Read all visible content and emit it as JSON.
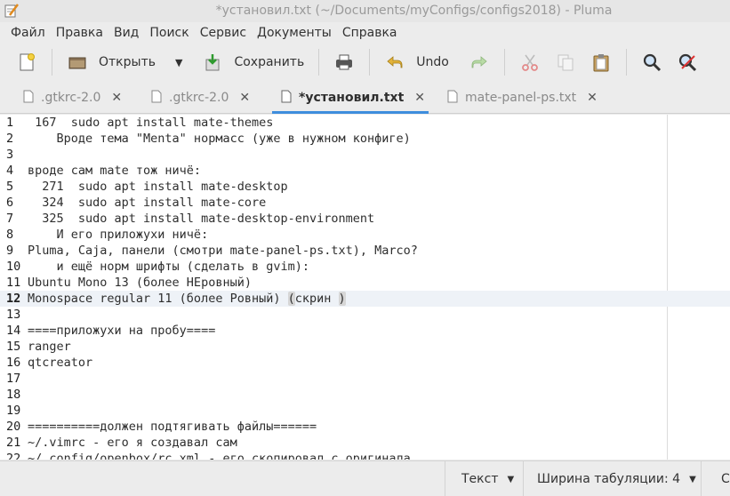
{
  "window": {
    "title": "*установил.txt (~/Documents/myConfigs/configs2018) - Pluma"
  },
  "menubar": {
    "items": [
      "Файл",
      "Правка",
      "Вид",
      "Поиск",
      "Сервис",
      "Документы",
      "Справка"
    ]
  },
  "toolbar": {
    "open_label": "Открыть",
    "save_label": "Сохранить",
    "undo_label": "Undo"
  },
  "tabs": [
    {
      "label": ".gtkrc-2.0",
      "active": false
    },
    {
      "label": ".gtkrc-2.0",
      "active": false
    },
    {
      "label": "*установил.txt",
      "active": true
    },
    {
      "label": "mate-panel-ps.txt",
      "active": false
    }
  ],
  "editor": {
    "current_line": 12,
    "lines": [
      {
        "n": "1",
        "text": " 167  sudo apt install mate-themes"
      },
      {
        "n": "2",
        "text": "    Вроде тема \"Menta\" нормасс (уже в нужном конфиге)"
      },
      {
        "n": "3",
        "text": ""
      },
      {
        "n": "4",
        "text": "вроде сам mate тож ничё:"
      },
      {
        "n": "5",
        "text": "  271  sudo apt install mate-desktop"
      },
      {
        "n": "6",
        "text": "  324  sudo apt install mate-core"
      },
      {
        "n": "7",
        "text": "  325  sudo apt install mate-desktop-environment"
      },
      {
        "n": "8",
        "text": "    И его приложухи ничё:"
      },
      {
        "n": "9",
        "text": "Pluma, Caja, панели (смотри mate-panel-ps.txt), Marco?"
      },
      {
        "n": "10",
        "text": "    и ещё норм шрифты (сделать в gvim):"
      },
      {
        "n": "11",
        "text": "Ubuntu Mono 13 (более НЕровный)"
      },
      {
        "n": "12",
        "text": "Monospace regular 11 (более Ровный) ",
        "bracket_text": "(",
        "after_text": "скрин ",
        "bracket_close": ")"
      },
      {
        "n": "13",
        "text": ""
      },
      {
        "n": "14",
        "text": "====приложухи на пробу===="
      },
      {
        "n": "15",
        "text": "ranger"
      },
      {
        "n": "16",
        "text": "qtcreator"
      },
      {
        "n": "17",
        "text": ""
      },
      {
        "n": "18",
        "text": ""
      },
      {
        "n": "19",
        "text": ""
      },
      {
        "n": "20",
        "text": "==========должен подтягивать файлы======"
      },
      {
        "n": "21",
        "text": "~/.vimrc - его я создавал сам"
      },
      {
        "n": "22",
        "text": "~/.config/openbox/rc.xml - его скопировал с оригинала"
      }
    ]
  },
  "statusbar": {
    "syntax_label": "Текст",
    "tab_width_label": "Ширина табуляции: 4",
    "position_label": "С"
  },
  "colors": {
    "accent": "#3e8ddd",
    "current_line": "#eef2f7"
  }
}
